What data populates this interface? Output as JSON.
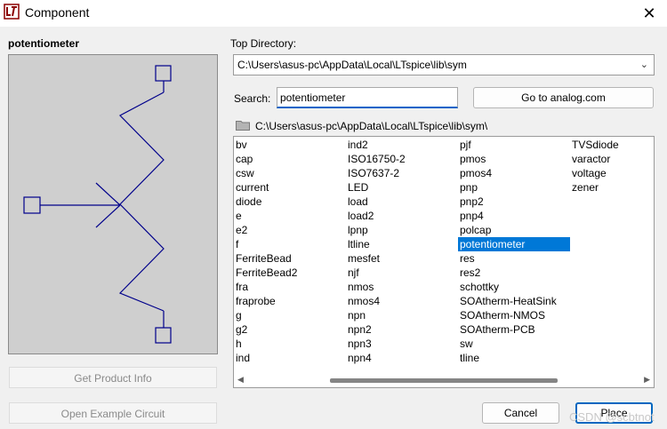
{
  "window": {
    "title": "Component"
  },
  "preview": {
    "title": "potentiometer"
  },
  "buttons": {
    "product_info": "Get Product Info",
    "example_circuit": "Open Example Circuit",
    "go_analog": "Go to analog.com",
    "cancel": "Cancel",
    "place": "Place"
  },
  "top_directory": {
    "label": "Top Directory:",
    "value": "C:\\Users\\asus-pc\\AppData\\Local\\LTspice\\lib\\sym"
  },
  "search": {
    "label": "Search:",
    "value": "potentiometer"
  },
  "current_path": "C:\\Users\\asus-pc\\AppData\\Local\\LTspice\\lib\\sym\\",
  "components": {
    "col1": [
      "bv",
      "cap",
      "csw",
      "current",
      "diode",
      "e",
      "e2",
      "f",
      "FerriteBead",
      "FerriteBead2",
      "fra",
      "fraprobe",
      "g",
      "g2",
      "h",
      "ind"
    ],
    "col2": [
      "ind2",
      "ISO16750-2",
      "ISO7637-2",
      "LED",
      "load",
      "load2",
      "lpnp",
      "ltline",
      "mesfet",
      "njf",
      "nmos",
      "nmos4",
      "npn",
      "npn2",
      "npn3",
      "npn4"
    ],
    "col3": [
      "pjf",
      "pmos",
      "pmos4",
      "pnp",
      "pnp2",
      "pnp4",
      "polcap",
      "potentiometer",
      "res",
      "res2",
      "schottky",
      "SOAtherm-HeatSink",
      "SOAtherm-NMOS",
      "SOAtherm-PCB",
      "sw",
      "tline"
    ],
    "col4": [
      "TVSdiode",
      "varactor",
      "voltage",
      "zener"
    ],
    "selected": "potentiometer"
  },
  "watermark": "CSDN @scbtnot",
  "colors": {
    "selection": "#0078d7",
    "symbol": "#00008b",
    "preview_bg": "#cfcfcf"
  }
}
